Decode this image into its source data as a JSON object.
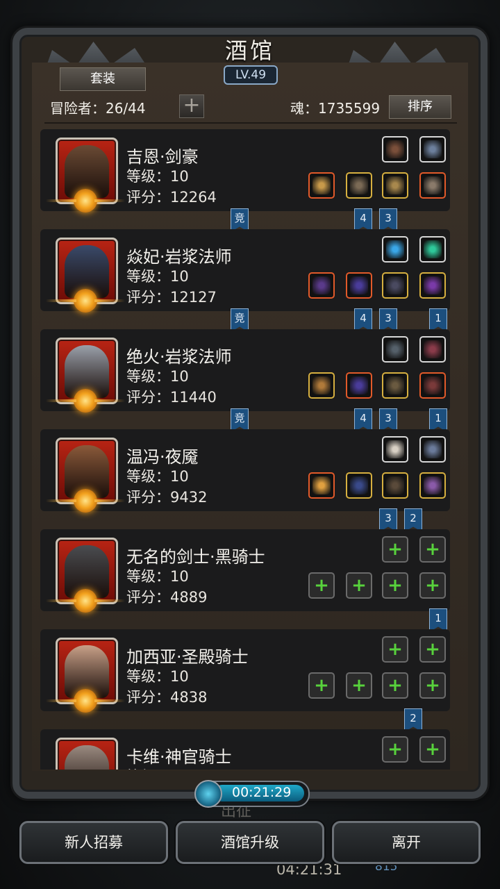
{
  "title": "酒馆",
  "level_badge": "LV.49",
  "set_button": "套装",
  "adventurers": "冒险者：26/44",
  "soul": "魂：1735599",
  "sort_button": "排序",
  "heroes": [
    {
      "name": "吉恩·剑豪",
      "level": "等级：10",
      "score": "评分：12264",
      "face": "#6a4a34",
      "top": [
        {
          "b": "white",
          "c": "#7a4f3a"
        },
        {
          "b": "white",
          "c": "#6c7f9c"
        }
      ],
      "bottom": [
        {
          "b": "orange",
          "c": "#c89a4a"
        },
        {
          "b": "gold",
          "c": "#7b6a55"
        },
        {
          "b": "gold",
          "c": "#a8884d"
        },
        {
          "b": "orange",
          "c": "#8a7a6a"
        }
      ],
      "tags": [
        "竞",
        "4",
        "3"
      ]
    },
    {
      "name": "焱妃·岩浆法师",
      "level": "等级：10",
      "score": "评分：12127",
      "face": "#3a4a6a",
      "top": [
        {
          "b": "white",
          "c": "#3aa7e8"
        },
        {
          "b": "white",
          "c": "#2ec89a"
        }
      ],
      "bottom": [
        {
          "b": "orange",
          "c": "#5a3a8a"
        },
        {
          "b": "orange",
          "c": "#4a3c9a"
        },
        {
          "b": "gold",
          "c": "#4a4a60"
        },
        {
          "b": "gold",
          "c": "#7a3aa8"
        }
      ],
      "tags": [
        "竞",
        "4",
        "3",
        "1"
      ]
    },
    {
      "name": "绝火·岩浆法师",
      "level": "等级：10",
      "score": "评分：11440",
      "face": "#9aa0aa",
      "top": [
        {
          "b": "white",
          "c": "#55606a"
        },
        {
          "b": "white",
          "c": "#8a3b4a"
        }
      ],
      "bottom": [
        {
          "b": "gold",
          "c": "#b07a3a"
        },
        {
          "b": "orange",
          "c": "#4a3c9a"
        },
        {
          "b": "gold",
          "c": "#6a5a40"
        },
        {
          "b": "orange",
          "c": "#7a3a3a"
        }
      ],
      "tags": [
        "竞",
        "4",
        "3",
        "1"
      ]
    },
    {
      "name": "温冯·夜魇",
      "level": "等级：10",
      "score": "评分：9432",
      "face": "#8a5a3a",
      "top": [
        {
          "b": "white",
          "c": "#d8d0c4"
        },
        {
          "b": "white",
          "c": "#6a7a9a"
        }
      ],
      "bottom": [
        {
          "b": "orange",
          "c": "#e0a040"
        },
        {
          "b": "gold",
          "c": "#3a4a8a"
        },
        {
          "b": "gold",
          "c": "#5a4a3a"
        },
        {
          "b": "gold",
          "c": "#8a5aa8"
        }
      ],
      "tags": [
        "3",
        "2"
      ]
    },
    {
      "name": "无名的剑士·黑骑士",
      "level": "等级：10",
      "score": "评分：4889",
      "face": "#4a4c50",
      "empty": true,
      "tags": [
        "1"
      ]
    },
    {
      "name": "加西亚·圣殿骑士",
      "level": "等级：10",
      "score": "评分：4838",
      "face": "#c8a088",
      "empty": true,
      "tags": [
        "2"
      ]
    },
    {
      "name": "卡维·神官骑士",
      "level": "等级",
      "score": "",
      "face": "#9a8a80",
      "empty": true,
      "tags": []
    }
  ],
  "empty_slot_icon": "+",
  "timer": "00:21:29",
  "bg_text_depart": "出征",
  "bg_time": "04:21:31",
  "bg_num": "815",
  "buttons": {
    "recruit": "新人招募",
    "upgrade": "酒馆升级",
    "leave": "离开"
  }
}
